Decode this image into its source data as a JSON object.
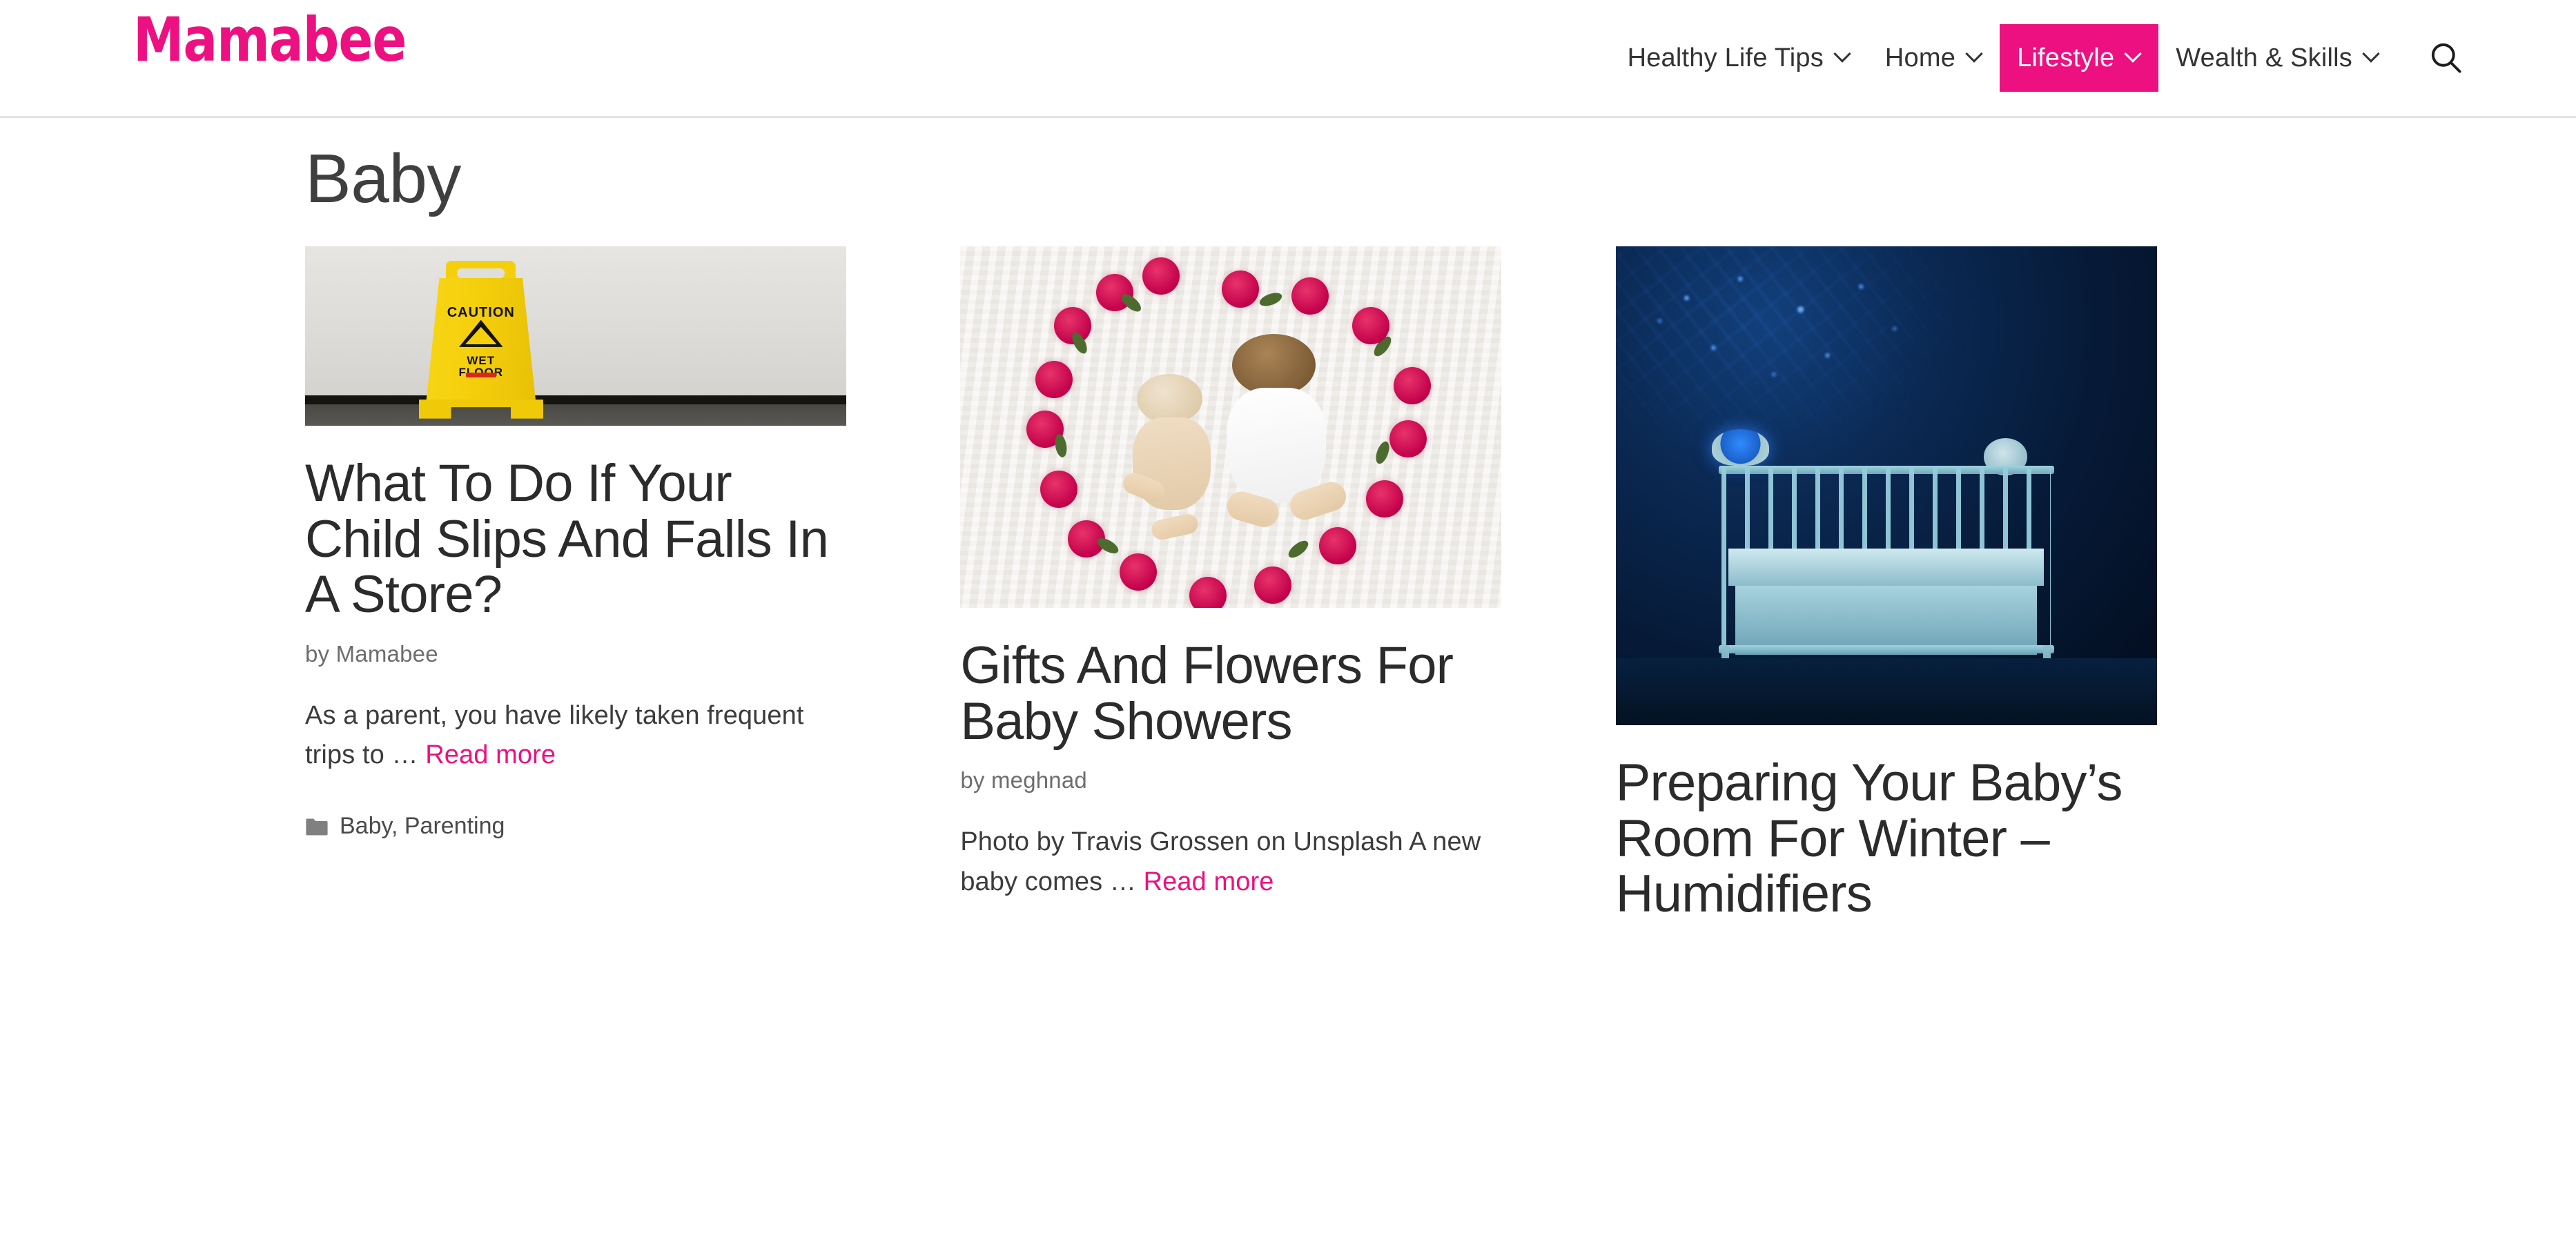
{
  "header": {
    "logo_text": "Mamabee",
    "logo_color": "#ED1080",
    "nav_items": [
      {
        "label": "Healthy Life Tips",
        "has_dropdown": true,
        "active": false
      },
      {
        "label": "Home",
        "has_dropdown": true,
        "active": false
      },
      {
        "label": "Lifestyle",
        "has_dropdown": true,
        "active": true
      },
      {
        "label": "Wealth & Skills",
        "has_dropdown": true,
        "active": false
      }
    ],
    "search_icon": "search-icon"
  },
  "page": {
    "archive_title": "Baby"
  },
  "posts": [
    {
      "title": "What To Do If Your Child Slips And Falls In A Store?",
      "byline": "by Mamabee",
      "excerpt": "As a parent, you have likely taken frequent trips to … ",
      "read_more": "Read more",
      "categories": "Baby, Parenting",
      "image_alt": "Yellow caution wet floor sign leaning against a white wall"
    },
    {
      "title": "Gifts And Flowers For Baby Showers",
      "byline": "by meghnad",
      "excerpt": "Photo by Travis Grossen on Unsplash A new baby comes … ",
      "read_more": "Read more",
      "categories": "",
      "image_alt": "Two babies lying on a white knit blanket inside a heart made of red flowers"
    },
    {
      "title": "Preparing Your Baby’s Room For Winter – Humidifiers",
      "byline": "",
      "excerpt": "",
      "read_more": "",
      "categories": "",
      "image_alt": "White crib in a dark nursery lit blue by a star projector"
    }
  ],
  "colors": {
    "accent_pink": "#ED1080",
    "title_gray": "#2b2b2b",
    "body_gray": "#3c3c3c",
    "meta_gray": "#6d6d6d",
    "header_border": "#e3e3e3"
  }
}
